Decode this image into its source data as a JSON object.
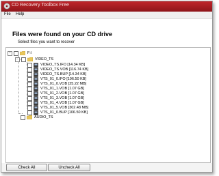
{
  "window": {
    "title": "CD Recovery Toolbox Free"
  },
  "menu": {
    "items": [
      "File",
      "Help"
    ]
  },
  "header": {
    "title": "Files were found on your CD drive",
    "subtitle": "Select files you want to recover"
  },
  "tree": {
    "root": {
      "label": "F:\\"
    },
    "folders": [
      {
        "label": "VIDEO_TS"
      },
      {
        "label": "AUDIO_TS"
      }
    ],
    "files": [
      {
        "label": "VIDEO_TS.IFO   [14.34 KB]"
      },
      {
        "label": "VIDEO_TS.VOB   [116.74 KB]"
      },
      {
        "label": "VIDEO_TS.BUP   [14.34 KB]"
      },
      {
        "label": "VTS_01_0.IFO   [106.50 KB]"
      },
      {
        "label": "VTS_01_0.VOB   [25.22 MB]"
      },
      {
        "label": "VTS_01_1.VOB   [1.07 GB]"
      },
      {
        "label": "VTS_01_2.VOB   [1.07 GB]"
      },
      {
        "label": "VTS_01_3.VOB   [1.07 GB]"
      },
      {
        "label": "VTS_01_4.VOB   [1.07 GB]"
      },
      {
        "label": "VTS_01_5.VOB   [302.48 MB]"
      },
      {
        "label": "VTS_01_0.BUP   [106.50 KB]"
      }
    ]
  },
  "footer": {
    "check_all": "Check All",
    "uncheck_all": "Uncheck All"
  },
  "colors": {
    "titlebar": "#a51d22",
    "folder": "#e8c65a"
  }
}
